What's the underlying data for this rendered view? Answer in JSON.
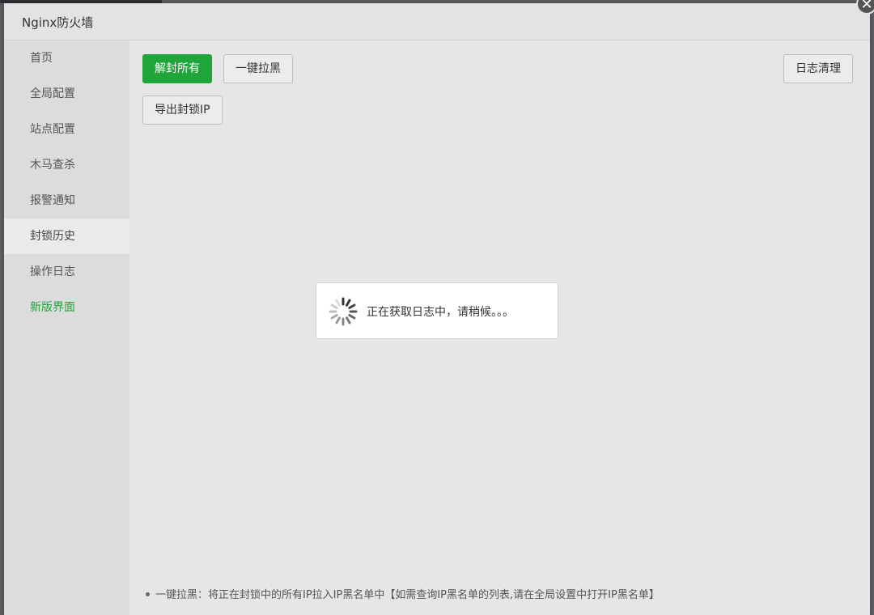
{
  "window": {
    "title": "Nginx防火墙"
  },
  "sidebar": {
    "items": [
      {
        "label": "首页"
      },
      {
        "label": "全局配置"
      },
      {
        "label": "站点配置"
      },
      {
        "label": "木马查杀"
      },
      {
        "label": "报警通知"
      },
      {
        "label": "封锁历史",
        "active": true
      },
      {
        "label": "操作日志"
      },
      {
        "label": "新版界面"
      }
    ]
  },
  "toolbar": {
    "unblock_all_label": "解封所有",
    "blacklist_label": "一键拉黑",
    "export_label": "导出封锁IP",
    "clean_log_label": "日志清理"
  },
  "loading": {
    "text": "正在获取日志中，请稍候。。。"
  },
  "footnote": {
    "text": "一键拉黑：将正在封锁中的所有IP拉入IP黑名单中【如需查询IP黑名单的列表,请在全局设置中打开IP黑名单】"
  },
  "colors": {
    "accent": "#20a53a",
    "sidebar_bg": "#dcdcdc",
    "content_bg": "#e6e6e6"
  }
}
